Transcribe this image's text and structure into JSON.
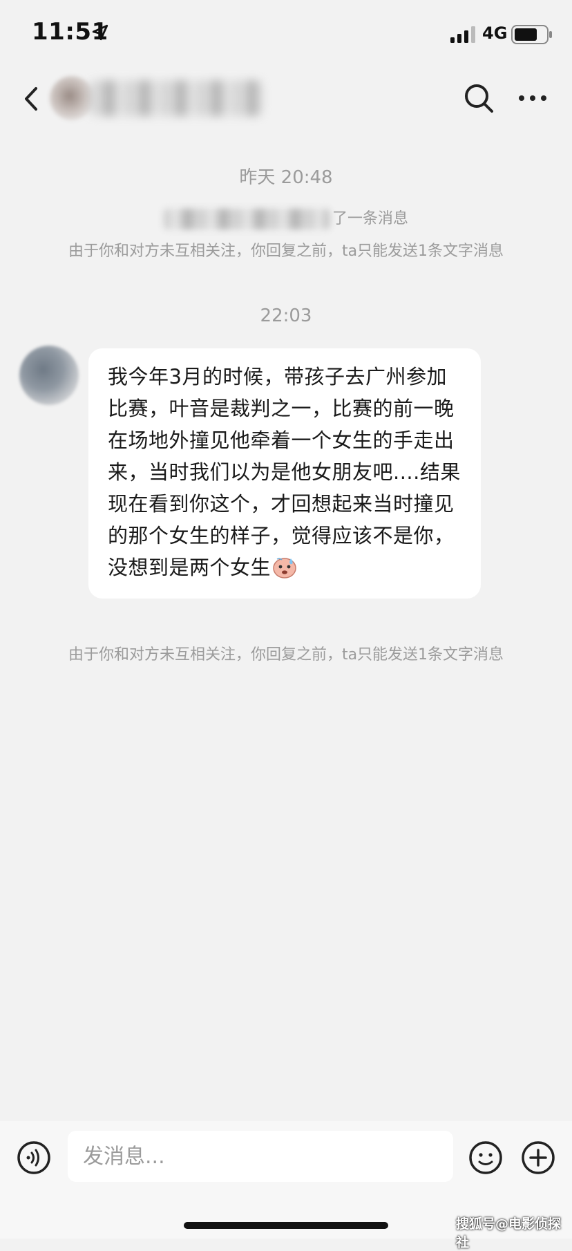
{
  "status_bar": {
    "time": "11:51",
    "network": "4G"
  },
  "header": {
    "icons": [
      "back-icon",
      "search-icon",
      "more-icon"
    ]
  },
  "messages": {
    "timestamp_1": "昨天 20:48",
    "system_msg_suffix": "了一条消息",
    "notice_text": "由于你和对方未互相关注，你回复之前，ta只能发送1条文字消息",
    "timestamp_2": "22:03",
    "bubble_text": "我今年3月的时候，带孩子去广州参加比赛，叶音是裁判之一，比赛的前一晚在场地外撞见他牵着一个女生的手走出来，当时我们以为是他女朋友吧....结果现在看到你这个，才回想起来当时撞见的那个女生的样子，觉得应该不是你，没想到是两个女生",
    "bubble_emoji": "sweat-face-emoji",
    "notice_text_2": "由于你和对方未互相关注，你回复之前，ta只能发送1条文字消息"
  },
  "input_bar": {
    "placeholder": "发消息...",
    "icons": [
      "voice-icon",
      "emoji-icon",
      "add-icon"
    ]
  },
  "watermark": "搜狐号@电影侦探社",
  "colors": {
    "background": "#f2f2f2",
    "bubble": "#ffffff",
    "muted_text": "#9b9b9b"
  }
}
